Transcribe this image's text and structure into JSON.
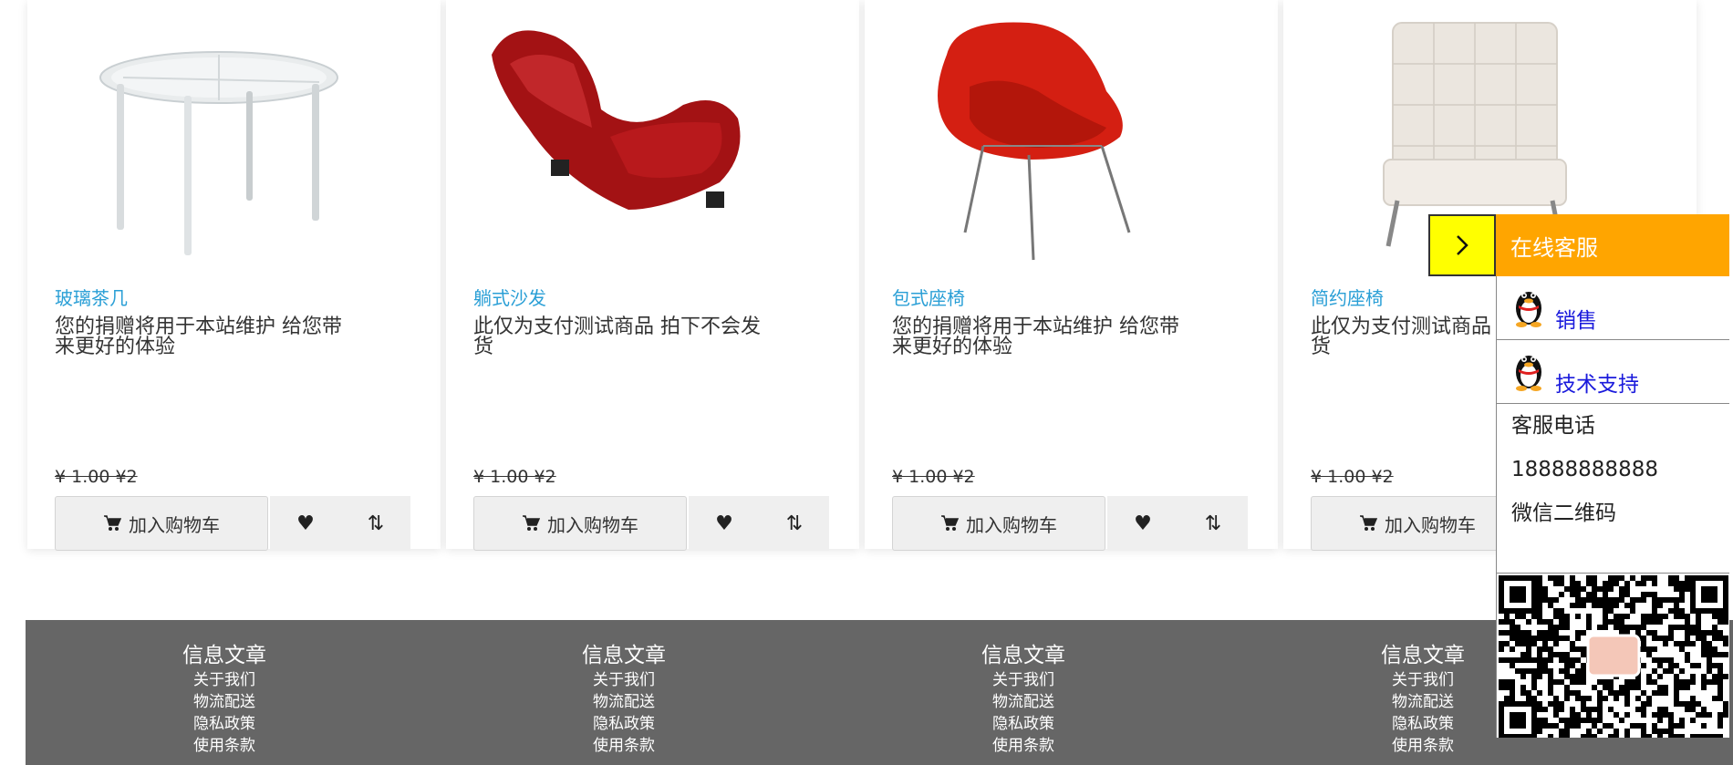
{
  "products": [
    {
      "category": "玻璃茶几",
      "description": "您的捐赠将用于本站维护 给您带来更好的体验",
      "price": "¥ 1.00 ¥2",
      "cart_label": "加入购物车"
    },
    {
      "category": "躺式沙发",
      "description": "此仅为支付测试商品 拍下不会发货",
      "price": "¥ 1.00 ¥2",
      "cart_label": "加入购物车"
    },
    {
      "category": "包式座椅",
      "description": "您的捐赠将用于本站维护 给您带来更好的体验",
      "price": "¥ 1.00 ¥2",
      "cart_label": "加入购物车"
    },
    {
      "category": "简约座椅",
      "description": "此仅为支付测试商品 拍下不会发货",
      "price": "¥ 1.00 ¥2",
      "cart_label": "加入购物车"
    }
  ],
  "footer": {
    "columns": [
      {
        "title": "信息文章",
        "links": [
          "关于我们",
          "物流配送",
          "隐私政策",
          "使用条款"
        ]
      },
      {
        "title": "信息文章",
        "links": [
          "关于我们",
          "物流配送",
          "隐私政策",
          "使用条款"
        ]
      },
      {
        "title": "信息文章",
        "links": [
          "关于我们",
          "物流配送",
          "隐私政策",
          "使用条款"
        ]
      },
      {
        "title": "信息文章",
        "links": [
          "关于我们",
          "物流配送",
          "隐私政策",
          "使用条款"
        ]
      }
    ]
  },
  "customer_service": {
    "title": "在线客服",
    "items": [
      {
        "label": "销售"
      },
      {
        "label": "技术支持"
      }
    ],
    "phone_label": "客服电话",
    "phone": "18888888888",
    "wechat_label": "微信二维码"
  },
  "colors": {
    "category": "#2a9fd6",
    "footer_bg": "#666666",
    "cs_header": "#ffa500",
    "cs_toggle": "#ffff00",
    "cs_link": "#1a1adc"
  },
  "icons": {
    "cart": "shopping-cart-icon",
    "favorite": "heart-icon",
    "compare": "compare-arrows-icon",
    "toggle": "chevron-right-icon",
    "cs_item": "qq-penguin-icon"
  }
}
